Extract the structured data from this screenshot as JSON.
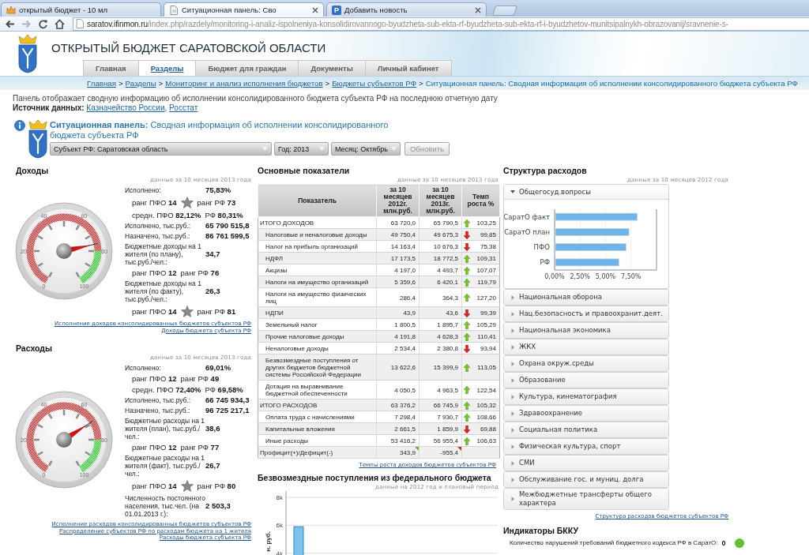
{
  "browser": {
    "tabs": [
      {
        "title": "открытый бюджет - 10 мл",
        "selected": false,
        "closable": false
      },
      {
        "title": "Ситуационная панель: Сво",
        "selected": true,
        "closable": true
      },
      {
        "letter": "P",
        "title": "Добавить новость",
        "selected": false,
        "closable": true
      }
    ],
    "forward_disabled": true,
    "url": "saratov.ifinmon.ru/index.php/razdely/monitoring-i-analiz-ispolneniya-konsolidirovannogo-byudzheta-sub-ekta-rf-byudzheta-sub-ekta-rf-i-byudzhetov-munitsipalnykh-obrazovanij/sravnenie-s-"
  },
  "site": {
    "title": "ОТКРЫТЫЙ БЮДЖЕТ САРАТОВСКОЙ ОБЛАСТИ",
    "nav": [
      {
        "label": "Главная",
        "selected": false
      },
      {
        "label": "Разделы",
        "selected": true
      },
      {
        "label": "Бюджет для граждан",
        "selected": false
      },
      {
        "label": "Документы",
        "selected": false
      },
      {
        "label": "Личный кабинет",
        "selected": false
      }
    ]
  },
  "breadcrumbs": [
    {
      "label": "Главная",
      "link": true,
      "separator": ">"
    },
    {
      "label": "Разделы",
      "link": true,
      "separator": ">"
    },
    {
      "label": "Мониторинг и анализ исполнения бюджетов",
      "link": true,
      "separator": ">"
    },
    {
      "label": "Бюджеты субъектов РФ",
      "link": true,
      "separator": ">"
    },
    {
      "label": "Ситуационная панель: Сводная информация об исполнении консолидированного бюджета субъекта РФ",
      "link": false
    }
  ],
  "intro": {
    "text": "Панель отображает сводную информацию об исполнении консолидированного бюджета субъекта РФ на последнюю отчетную дату",
    "source_label": "Источник данных:",
    "sources": [
      {
        "label": "Казначейство России",
        "separator": ","
      },
      {
        "label": "Росстат"
      }
    ]
  },
  "panel": {
    "heading": "**Ситуационная панель:** Сводная информация об исполнении консолидированного бюджета субъекта РФ",
    "filters": [
      {
        "label": "Субъект РФ: Саратовская область"
      },
      {
        "label": "Год: 2013"
      },
      {
        "label": "Месяц: Октябрь"
      }
    ],
    "button": {
      "label": "Обновить",
      "disabled": true
    }
  },
  "income": {
    "title": "Доходы",
    "note": "данные за 10 месяцев 2013 года",
    "gauge": {
      "level": 0.7583,
      "scale": [
        "0",
        "20",
        "40",
        "60",
        "80",
        "100"
      ]
    },
    "stats": [
      {
        "kind": "value",
        "label": "Исполнено:",
        "value": "75,83%"
      },
      {
        "kind": "rank",
        "parts": [
          "ранг ПФО **14**",
          "ранг РФ **73**"
        ],
        "starred": true
      },
      {
        "kind": "pair",
        "parts": [
          "средн. ПФО **82,12%**",
          "РФ **80,31%**"
        ]
      },
      {
        "kind": "value",
        "label": "Исполнено, тыс.руб.:",
        "value": "65 790 515,8"
      },
      {
        "kind": "value",
        "label": "Назначено, тыс.руб.:",
        "value": "86 761 599,5"
      },
      {
        "kind": "value",
        "label": "Бюджетные доходы на 1 жителя (по плану), тыс.руб./чел.:",
        "value": "34,7"
      },
      {
        "kind": "rank",
        "parts": [
          "ранг ПФО **12**",
          "ранг РФ **76**"
        ],
        "starred": false
      },
      {
        "kind": "value",
        "label": "Бюджетные доходы на 1 жителя (по факту), тыс.руб./чел.:",
        "value": "26,3"
      },
      {
        "kind": "rank",
        "parts": [
          "ранг ПФО **14**",
          "ранг РФ **81**"
        ],
        "starred": true
      }
    ],
    "links": [
      "Исполнение доходов консолидированных бюджетов субъектов РФ",
      "Доходы бюджета субъекта РФ"
    ]
  },
  "expenses": {
    "title": "Расходы",
    "note": "данные за 10 месяцев 2013 года",
    "gauge": {
      "level": 0.6901,
      "scale": [
        "0",
        "20",
        "40",
        "60",
        "80",
        "100"
      ]
    },
    "stats": [
      {
        "kind": "value",
        "label": "Исполнено:",
        "value": "69,01%"
      },
      {
        "kind": "rank",
        "parts": [
          "ранг ПФО **12**",
          "ранг РФ **49**"
        ],
        "starred": false
      },
      {
        "kind": "pair",
        "parts": [
          "средн. ПФО **72,40%**",
          "РФ **69,58%**"
        ]
      },
      {
        "kind": "value",
        "label": "Исполнено, тыс.руб.:",
        "value": "66 745 934,3"
      },
      {
        "kind": "value",
        "label": "Назначено, тыс.руб.:",
        "value": "96 725 217,1"
      },
      {
        "kind": "value",
        "label": "Бюджетные расходы на 1 жителя (план), тыс.руб./чел.:",
        "value": "38,6"
      },
      {
        "kind": "rank",
        "parts": [
          "ранг ПФО **12**",
          "ранг РФ **77**"
        ],
        "starred": false
      },
      {
        "kind": "value",
        "label": "Бюджетные расходы на 1 жителя (факт), тыс.руб./чел.:",
        "value": "26,7"
      },
      {
        "kind": "rank",
        "parts": [
          "ранг ПФО **14**",
          "ранг РФ **80**"
        ],
        "starred": true
      },
      {
        "kind": "value",
        "label": "Численность постоянного населения, тыс.чел. (на 01.01.2013 г.):",
        "value": "2 503,3"
      }
    ],
    "links": [
      "Исполнение расходов консолидированных бюджетов субъектов РФ",
      "Распределение субъектов РФ по расходам бюджета на 1 жителя",
      "Расходы бюджета субъекта РФ"
    ]
  },
  "indicators": {
    "title": "Основные показатели",
    "note": "данные за 10 месяцев 2013 года",
    "columns": [
      "Показатель",
      "за 10 месяцев 2012г. млн.руб.",
      "за 10 месяцев 2013г. млн.руб.",
      "Темп роста %"
    ],
    "rows": [
      {
        "kind": "total",
        "name": "ИТОГО ДОХОДОВ",
        "values": [
          {
            "text": "63 720,0"
          },
          {
            "text": "65 790,5"
          }
        ],
        "growth": true,
        "rate": "103,25"
      },
      {
        "kind": "item",
        "name": "Налоговые и неналоговые доходы",
        "values": [
          {
            "text": "49 750,4"
          },
          {
            "text": "49 675,3"
          }
        ],
        "growth": false,
        "rate": "99,85"
      },
      {
        "kind": "item",
        "name": "Налог на прибыль организаций",
        "values": [
          {
            "text": "14 163,4"
          },
          {
            "text": "10 676,3"
          }
        ],
        "growth": false,
        "rate": "75,38"
      },
      {
        "kind": "item",
        "name": "НДФЛ",
        "values": [
          {
            "text": "17 173,5"
          },
          {
            "text": "18 772,5"
          }
        ],
        "growth": true,
        "rate": "109,31"
      },
      {
        "kind": "item",
        "name": "Акцизы",
        "values": [
          {
            "text": "4 197,0"
          },
          {
            "text": "4 493,7"
          }
        ],
        "growth": true,
        "rate": "107,07"
      },
      {
        "kind": "item",
        "name": "Налоги на имущество организаций",
        "values": [
          {
            "text": "5 359,6"
          },
          {
            "text": "6 420,1"
          }
        ],
        "growth": true,
        "rate": "119,79"
      },
      {
        "kind": "item",
        "name": "Налоги на имущество физических лиц",
        "values": [
          {
            "text": "286,4"
          },
          {
            "text": "364,3"
          }
        ],
        "growth": true,
        "rate": "127,20"
      },
      {
        "kind": "item",
        "name": "НДПИ",
        "values": [
          {
            "text": "43,9"
          },
          {
            "text": "43,6"
          }
        ],
        "growth": false,
        "rate": "99,39"
      },
      {
        "kind": "item",
        "name": "Земельный налог",
        "values": [
          {
            "text": "1 800,5"
          },
          {
            "text": "1 895,7"
          }
        ],
        "growth": true,
        "rate": "105,29"
      },
      {
        "kind": "item",
        "name": "Прочие налоговые доходы",
        "values": [
          {
            "text": "4 191,8"
          },
          {
            "text": "4 628,3"
          }
        ],
        "growth": true,
        "rate": "110,41"
      },
      {
        "kind": "item",
        "name": "Неналоговые доходы",
        "values": [
          {
            "text": "2 534,4"
          },
          {
            "text": "2 380,8"
          }
        ],
        "growth": false,
        "rate": "93,94"
      },
      {
        "kind": "item",
        "name": "Безвозмездные поступления от других бюджетов бюджетной системы Российской Федерации",
        "values": [
          {
            "text": "13 622,6"
          },
          {
            "text": "15 399,9"
          }
        ],
        "growth": true,
        "rate": "113,05"
      },
      {
        "kind": "item",
        "name": "Дотация на выравнивание бюджетной обеспеченности",
        "values": [
          {
            "text": "4 050,5"
          },
          {
            "text": "4 963,5"
          }
        ],
        "growth": true,
        "rate": "122,54"
      },
      {
        "kind": "total",
        "name": "ИТОГО РАСХОДОВ",
        "values": [
          {
            "text": "63 376,2"
          },
          {
            "text": "66 745,9"
          }
        ],
        "growth": true,
        "rate": "105,32"
      },
      {
        "kind": "item",
        "name": "Оплата труда с начислениями",
        "values": [
          {
            "text": "7 298,4"
          },
          {
            "text": "7 930,7"
          }
        ],
        "growth": true,
        "rate": "108,66"
      },
      {
        "kind": "item",
        "name": "Капитальные вложения",
        "values": [
          {
            "text": "2 661,5"
          },
          {
            "text": "1 859,9"
          }
        ],
        "growth": false,
        "rate": "69,88"
      },
      {
        "kind": "item",
        "name": "Иные расходы",
        "values": [
          {
            "text": "53 416,2"
          },
          {
            "text": "56 955,4"
          }
        ],
        "growth": true,
        "rate": "106,63"
      },
      {
        "kind": "total",
        "name": "Профицит(+)/Дефицит(-)",
        "values": [
          {
            "text": "343,9",
            "color": "#5cb531"
          },
          {
            "text": "-955,4",
            "color": "#d42a2a"
          }
        ]
      }
    ],
    "link": "Темпы роста доходов бюджетов субъектов РФ"
  },
  "transfers": {
    "title": "Безвозмездные поступления из федерального бюджета",
    "note": "данные на 2012 год и плановый период",
    "chart_data": {
      "type": "bar",
      "ylabel": "н. руб.",
      "values": [
        5900
      ],
      "ylim": [
        3700,
        8450
      ],
      "yticks": [
        {
          "value": 4000,
          "label": "4k"
        },
        {
          "value": 6000,
          "label": "6k"
        },
        {
          "value": 8000,
          "label": "8k"
        }
      ],
      "grid": true
    }
  },
  "structure": {
    "title": "Структура расходов",
    "note": "данные за 10 месяцев 2012 года",
    "sections": [
      {
        "label": "Общегосуд.вопросы",
        "expanded": true,
        "chart_data": {
          "type": "bar",
          "orientation": "horizontal",
          "categories": [
            "СаратО факт",
            "СаратО план",
            "ПФО",
            "РФ"
          ],
          "values": [
            8.1,
            7.3,
            7.0,
            6.3
          ],
          "xlim": [
            0,
            10
          ],
          "xticks": [
            {
              "value": 0,
              "label": "0,00%"
            },
            {
              "value": 2.5,
              "label": "2,50%"
            },
            {
              "value": 5,
              "label": "5,00%"
            },
            {
              "value": 7.5,
              "label": "7,50%"
            }
          ],
          "grid": true
        }
      },
      {
        "label": "Национальная оборона",
        "expanded": false
      },
      {
        "label": "Нац.безопасность и правоохранит.деят.",
        "expanded": false
      },
      {
        "label": "Национальная экономика",
        "expanded": false
      },
      {
        "label": "ЖКХ",
        "expanded": false
      },
      {
        "label": "Охрана окруж.среды",
        "expanded": false
      },
      {
        "label": "Образование",
        "expanded": false
      },
      {
        "label": "Культура, кинематография",
        "expanded": false
      },
      {
        "label": "Здравоохранение",
        "expanded": false
      },
      {
        "label": "Социальная политика",
        "expanded": false
      },
      {
        "label": "Физическая культура, спорт",
        "expanded": false
      },
      {
        "label": "СМИ",
        "expanded": false
      },
      {
        "label": "Обслуживание гос. и муниц. долга",
        "expanded": false
      },
      {
        "label": "Межбюджетные трансферты общего характера",
        "expanded": false
      }
    ],
    "link": "Структура расходов бюджетов субъектов РФ"
  },
  "bkku": {
    "title": "Индикаторы БККУ",
    "items": [
      {
        "label": "Количество нарушений требований бюджетного кодекса РФ в СаратО:",
        "value": "0",
        "color": "#5fc22e"
      }
    ]
  }
}
